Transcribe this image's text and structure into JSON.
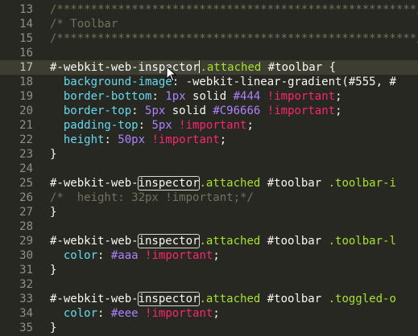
{
  "editor": {
    "theme_colors": {
      "background": "#272822",
      "active_line": "#3e3d32",
      "comment": "#75715e",
      "selector": "#f8f8f2",
      "class_selector": "#a6e22e",
      "property": "#66d9ef",
      "number": "#ae81ff",
      "important": "#f92672"
    },
    "lines": [
      {
        "n": "13",
        "tokens": [
          {
            "t": "comment",
            "v": "/*****************************************************/"
          }
        ]
      },
      {
        "n": "14",
        "tokens": [
          {
            "t": "comment",
            "v": "/* Toolbar"
          }
        ]
      },
      {
        "n": "15",
        "tokens": [
          {
            "t": "comment",
            "v": "/*****************************************************/"
          }
        ]
      },
      {
        "n": "16",
        "tokens": []
      },
      {
        "n": "17",
        "active": true,
        "tokens": [
          {
            "t": "plain",
            "v": "#-webkit-web-"
          },
          {
            "t": "match-active",
            "v": "inspector"
          },
          {
            "t": "caret",
            "v": ""
          },
          {
            "t": "cls",
            "v": ".attached"
          },
          {
            "t": "plain",
            "v": " #toolbar {"
          }
        ]
      },
      {
        "n": "18",
        "tokens": [
          {
            "t": "plain",
            "v": "  "
          },
          {
            "t": "prop",
            "v": "background-image"
          },
          {
            "t": "plain",
            "v": ": -webkit-linear-gradient(#555, #"
          }
        ]
      },
      {
        "n": "19",
        "tokens": [
          {
            "t": "plain",
            "v": "  "
          },
          {
            "t": "prop",
            "v": "border-bottom"
          },
          {
            "t": "plain",
            "v": ": "
          },
          {
            "t": "num",
            "v": "1px"
          },
          {
            "t": "plain",
            "v": " solid "
          },
          {
            "t": "num",
            "v": "#444"
          },
          {
            "t": "plain",
            "v": " "
          },
          {
            "t": "imp",
            "v": "!important"
          },
          {
            "t": "plain",
            "v": ";"
          }
        ]
      },
      {
        "n": "20",
        "tokens": [
          {
            "t": "plain",
            "v": "  "
          },
          {
            "t": "prop",
            "v": "border-top"
          },
          {
            "t": "plain",
            "v": ": "
          },
          {
            "t": "num",
            "v": "5px"
          },
          {
            "t": "plain",
            "v": " solid "
          },
          {
            "t": "num",
            "v": "#C96666"
          },
          {
            "t": "plain",
            "v": " "
          },
          {
            "t": "imp",
            "v": "!important"
          },
          {
            "t": "plain",
            "v": ";"
          }
        ]
      },
      {
        "n": "21",
        "tokens": [
          {
            "t": "plain",
            "v": "  "
          },
          {
            "t": "prop",
            "v": "padding-top"
          },
          {
            "t": "plain",
            "v": ": "
          },
          {
            "t": "num",
            "v": "5px"
          },
          {
            "t": "plain",
            "v": " "
          },
          {
            "t": "imp",
            "v": "!important"
          },
          {
            "t": "plain",
            "v": ";"
          }
        ]
      },
      {
        "n": "22",
        "tokens": [
          {
            "t": "plain",
            "v": "  "
          },
          {
            "t": "prop",
            "v": "height"
          },
          {
            "t": "plain",
            "v": ": "
          },
          {
            "t": "num",
            "v": "50px"
          },
          {
            "t": "plain",
            "v": " "
          },
          {
            "t": "imp",
            "v": "!important"
          },
          {
            "t": "plain",
            "v": ";"
          }
        ]
      },
      {
        "n": "23",
        "tokens": [
          {
            "t": "plain",
            "v": "}"
          }
        ]
      },
      {
        "n": "24",
        "tokens": []
      },
      {
        "n": "25",
        "tokens": [
          {
            "t": "plain",
            "v": "#-webkit-web-"
          },
          {
            "t": "match",
            "v": "inspector"
          },
          {
            "t": "cls",
            "v": ".attached"
          },
          {
            "t": "plain",
            "v": " #toolbar "
          },
          {
            "t": "cls",
            "v": ".toolbar-i"
          }
        ]
      },
      {
        "n": "26",
        "tokens": [
          {
            "t": "comment",
            "v": "/*  height: 32px !important;*/"
          }
        ]
      },
      {
        "n": "27",
        "tokens": [
          {
            "t": "plain",
            "v": "}"
          }
        ]
      },
      {
        "n": "28",
        "tokens": []
      },
      {
        "n": "29",
        "tokens": [
          {
            "t": "plain",
            "v": "#-webkit-web-"
          },
          {
            "t": "match",
            "v": "inspector"
          },
          {
            "t": "cls",
            "v": ".attached"
          },
          {
            "t": "plain",
            "v": " #toolbar "
          },
          {
            "t": "cls",
            "v": ".toolbar-l"
          }
        ]
      },
      {
        "n": "30",
        "tokens": [
          {
            "t": "plain",
            "v": "  "
          },
          {
            "t": "prop",
            "v": "color"
          },
          {
            "t": "plain",
            "v": ": "
          },
          {
            "t": "num",
            "v": "#aaa"
          },
          {
            "t": "plain",
            "v": " "
          },
          {
            "t": "imp",
            "v": "!important"
          },
          {
            "t": "plain",
            "v": ";"
          }
        ]
      },
      {
        "n": "31",
        "tokens": [
          {
            "t": "plain",
            "v": "}"
          }
        ]
      },
      {
        "n": "32",
        "tokens": []
      },
      {
        "n": "33",
        "tokens": [
          {
            "t": "plain",
            "v": "#-webkit-web-"
          },
          {
            "t": "match",
            "v": "inspector"
          },
          {
            "t": "cls",
            "v": ".attached"
          },
          {
            "t": "plain",
            "v": " #toolbar "
          },
          {
            "t": "cls",
            "v": ".toggled-o"
          }
        ]
      },
      {
        "n": "34",
        "tokens": [
          {
            "t": "plain",
            "v": "  "
          },
          {
            "t": "prop",
            "v": "color"
          },
          {
            "t": "plain",
            "v": ": "
          },
          {
            "t": "num",
            "v": "#eee"
          },
          {
            "t": "plain",
            "v": " "
          },
          {
            "t": "imp",
            "v": "!important"
          },
          {
            "t": "plain",
            "v": ";"
          }
        ]
      },
      {
        "n": "35",
        "tokens": [
          {
            "t": "plain",
            "v": "}"
          }
        ]
      }
    ]
  }
}
